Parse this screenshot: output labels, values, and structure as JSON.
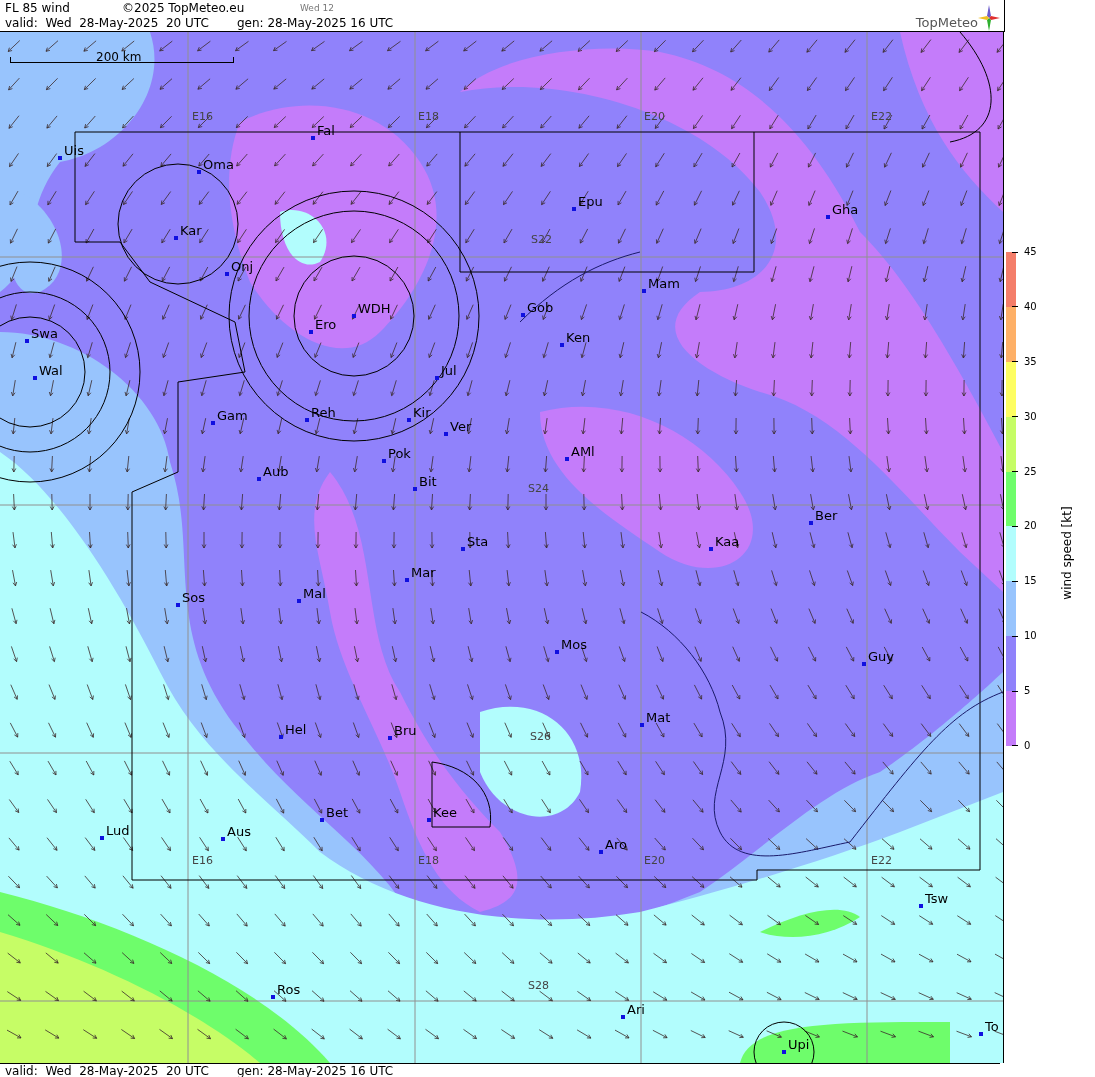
{
  "header": {
    "title": "FL 85 wind",
    "copyright": "©2025 TopMeteo.eu",
    "day_tab": "Wed 12",
    "valid": "valid:  Wed  28-May-2025  20 UTC",
    "generated": "gen: 28-May-2025 16 UTC",
    "logo": "TopMeteo"
  },
  "map": {
    "scale": "200 km",
    "grid_labels": [
      "E16",
      "E18",
      "E20",
      "E22",
      "S22",
      "S24",
      "S26",
      "E16",
      "E18",
      "E20",
      "E22",
      "S28"
    ],
    "places": [
      "Uis",
      "Oma",
      "Kar",
      "Onj",
      "Fal",
      "Epu",
      "Gha",
      "Mam",
      "Gob",
      "Ken",
      "WDH",
      "Ero",
      "Swa",
      "Wal",
      "Jul",
      "Gam",
      "Reh",
      "Kir",
      "Ver",
      "Pok",
      "AMl",
      "Bit",
      "Aub",
      "Ber",
      "Sta",
      "Kaa",
      "Mar",
      "Sos",
      "Mal",
      "Mos",
      "Guy",
      "Mat",
      "Hel",
      "Bru",
      "Kee",
      "Bet",
      "Lud",
      "Aus",
      "Aro",
      "Tsw",
      "Ros",
      "Ari",
      "Upi",
      "To"
    ]
  },
  "legend": {
    "title": "wind speed [kt]",
    "bands": [
      {
        "color": "#f47e6a"
      },
      {
        "color": "#feb067"
      },
      {
        "color": "#fefe62"
      },
      {
        "color": "#c6fd66"
      },
      {
        "color": "#6efd6b"
      },
      {
        "color": "#b2fdfd"
      },
      {
        "color": "#98c4fd"
      },
      {
        "color": "#9082fb"
      },
      {
        "color": "#c47cfa"
      }
    ],
    "ticks": [
      "45",
      "40",
      "35",
      "30",
      "25",
      "20",
      "15",
      "10",
      "5",
      "0"
    ]
  },
  "footer": {
    "valid": "valid:  Wed  28-May-2025  20 UTC",
    "generated": "gen: 28-May-2025 16 UTC"
  }
}
